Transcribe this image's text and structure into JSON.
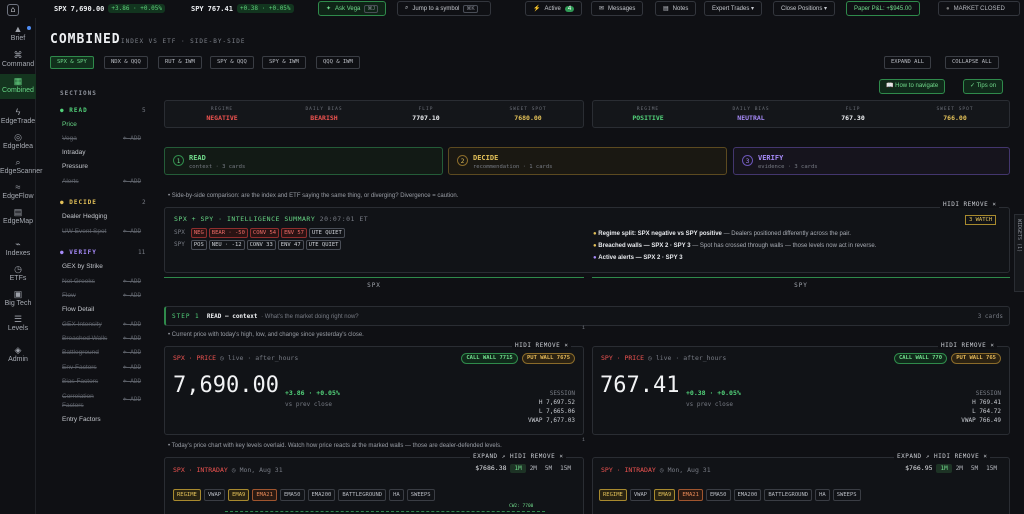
{
  "topbar": {
    "spx_sym": "SPX",
    "spx_price": "7,690.00",
    "spx_chg": "+3.86 · +0.05%",
    "spy_sym": "SPY",
    "spy_price": "767.41",
    "spy_chg": "+0.38 · +0.05%",
    "ask": "Ask Vega",
    "ask_key": "⌘J",
    "jump": "Jump to a symbol",
    "jump_key": "⌘K",
    "active": "Active",
    "active_count": "4",
    "messages": "Messages",
    "notes": "Notes",
    "expert": "Expert Trades ▾",
    "close": "Close Positions ▾",
    "pnl": "Paper P&L: +$945.00",
    "market": "MARKET CLOSED"
  },
  "sidebar": [
    {
      "label": "Brief",
      "icon": "▲"
    },
    {
      "label": "Command",
      "icon": "⌘"
    },
    {
      "label": "Combined",
      "icon": "▦"
    },
    {
      "label": "EdgeTrade",
      "icon": "ϟ"
    },
    {
      "label": "EdgeIdea",
      "icon": "◎"
    },
    {
      "label": "EdgeScanner",
      "icon": "⌕"
    },
    {
      "label": "EdgeFlow",
      "icon": "≈"
    },
    {
      "label": "EdgeMap",
      "icon": "▤"
    },
    {
      "label": "Indexes",
      "icon": "⌁"
    },
    {
      "label": "ETFs",
      "icon": "◷"
    },
    {
      "label": "Big Tech",
      "icon": "▣"
    },
    {
      "label": "Levels",
      "icon": "☰"
    },
    {
      "label": "Admin",
      "icon": "◈"
    }
  ],
  "page": {
    "title": "COMBINED",
    "subtitle": "INDEX VS ETF · SIDE-BY-SIDE",
    "expand_all": "EXPAND ALL",
    "collapse_all": "COLLAPSE ALL",
    "navigate": "How to navigate",
    "tips": "Tips on"
  },
  "pairs": [
    "SPX & SPY",
    "NDX & QQQ",
    "RUT & IWM",
    "SPY & QQQ",
    "SPY & IWM",
    "QQQ & IWM"
  ],
  "sections": {
    "header": "SECTIONS",
    "read": {
      "label": "READ",
      "count": "5",
      "items": [
        {
          "label": "Price",
          "add": ""
        },
        {
          "label": "Vega",
          "add": "+ ADD"
        },
        {
          "label": "Intraday",
          "add": ""
        },
        {
          "label": "Pressure",
          "add": ""
        },
        {
          "label": "Alerts",
          "add": "+ ADD"
        }
      ]
    },
    "decide": {
      "label": "DECIDE",
      "count": "2",
      "items": [
        {
          "label": "Dealer Hedging",
          "add": ""
        },
        {
          "label": "UW Event Spot",
          "add": "+ ADD"
        }
      ]
    },
    "verify": {
      "label": "VERIFY",
      "count": "11",
      "items": [
        {
          "label": "GEX by Strike",
          "add": ""
        },
        {
          "label": "Net Greeks",
          "add": "+ ADD"
        },
        {
          "label": "Flow",
          "add": "+ ADD"
        },
        {
          "label": "Flow Detail",
          "add": ""
        },
        {
          "label": "GEX Intensity",
          "add": "+ ADD"
        },
        {
          "label": "Breached Walls",
          "add": "+ ADD"
        },
        {
          "label": "Battleground",
          "add": "+ ADD"
        },
        {
          "label": "Env Factors",
          "add": "+ ADD"
        },
        {
          "label": "Bias Factors",
          "add": "+ ADD"
        },
        {
          "label": "Correlation Factors",
          "add": "+ ADD"
        },
        {
          "label": "Entry Factors",
          "add": ""
        }
      ]
    }
  },
  "regime_left": {
    "regime_l": "REGIME",
    "regime": "NEGATIVE",
    "bias_l": "DAILY BIAS",
    "bias": "BEARISH",
    "flip_l": "FLIP",
    "flip": "7707.10",
    "sweet_l": "SWEET SPOT",
    "sweet": "7680.00"
  },
  "regime_right": {
    "regime_l": "REGIME",
    "regime": "POSITIVE",
    "bias_l": "DAILY BIAS",
    "bias": "NEUTRAL",
    "flip_l": "FLIP",
    "flip": "767.30",
    "sweet_l": "SWEET SPOT",
    "sweet": "766.00"
  },
  "steps": [
    {
      "n": "1",
      "title": "READ",
      "sub": "context · 3 cards"
    },
    {
      "n": "2",
      "title": "DECIDE",
      "sub": "recommendation · 1 cards"
    },
    {
      "n": "3",
      "title": "VERIFY",
      "sub": "evidence · 3 cards"
    }
  ],
  "note1": "• Side-by-side comparison: are the index and ETF saying the same thing, or diverging? Divergence = caution.",
  "summary": {
    "title": "SPX + SPY · INTELLIGENCE SUMMARY",
    "time": "20:07:01 ET",
    "watch": "3 WATCH",
    "hide": "HIDI REMOVE ×",
    "spx": "SPX",
    "spx_tags": [
      "NEG",
      "BEAR · -50",
      "CONV 54",
      "ENV 57",
      "UTE QUIET"
    ],
    "spy": "SPY",
    "spy_tags": [
      "POS",
      "NEU · -12",
      "CONV 33",
      "ENV 47",
      "UTE QUIET"
    ],
    "b1_bold": "Regime split: SPX negative vs SPY positive",
    "b1": " — Dealers positioned differently across the pair.",
    "b2_bold": "Breached walls — SPX 2 · SPY 3",
    "b2": " — Spot has crossed through walls — those levels now act in reverse.",
    "b3_bold": "Active alerts — SPX 2 · SPY 3",
    "b3": "",
    "widget": "WIDGETS (1)"
  },
  "col_left": "SPX",
  "col_right": "SPY",
  "step1": {
    "label": "STEP 1",
    "name": "READ — context",
    "q": "· What's the market doing right now?",
    "cards": "3 cards"
  },
  "note2": "• Current price with today's high, low, and change since yesterday's close.",
  "price_left": {
    "title": "SPX · PRICE",
    "live": "live · after_hours",
    "call": "CALL WALL 7715",
    "put": "PUT WALL 7675",
    "price": "7,690.00",
    "chg": "+3.86 · +0.05%",
    "vs": "vs prev close",
    "session": "SESSION",
    "h": "H 7,697.52",
    "l": "L 7,665.06",
    "vwap": "VWAP 7,677.03",
    "hide": "HIDI REMOVE ×"
  },
  "price_right": {
    "title": "SPY · PRICE",
    "live": "live · after_hours",
    "call": "CALL WALL 770",
    "put": "PUT WALL 765",
    "price": "767.41",
    "chg": "+0.38 · +0.05%",
    "vs": "vs prev close",
    "session": "SESSION",
    "h": "H 769.41",
    "l": "L 764.72",
    "vwap": "VWAP 766.49",
    "hide": "HIDI REMOVE ×"
  },
  "note3": "• Today's price chart with key levels overlaid. Watch how price reacts at the marked walls — those are dealer-defended levels.",
  "intra_left": {
    "title": "SPX · INTRADAY",
    "date": "Mon, Aug 31",
    "px": "$7686.38",
    "tfs": [
      "1M",
      "2M",
      "5M",
      "15M"
    ],
    "ovs": [
      "REGIME",
      "VWAP",
      "EMA9",
      "EMA21",
      "EMA50",
      "EMA200",
      "BATTLEGROUND",
      "HA",
      "SWEEPS"
    ],
    "cw": "CW2: 7700",
    "hide": "EXPAND ↗   HIDI REMOVE ×"
  },
  "intra_right": {
    "title": "SPY · INTRADAY",
    "date": "Mon, Aug 31",
    "px": "$766.95",
    "tfs": [
      "1M",
      "2M",
      "5M",
      "15M"
    ],
    "ovs": [
      "REGIME",
      "VWAP",
      "EMA9",
      "EMA21",
      "EMA50",
      "EMA200",
      "BATTLEGROUND",
      "HA",
      "SWEEPS"
    ],
    "hide": "EXPAND ↗   HIDI REMOVE ×"
  }
}
